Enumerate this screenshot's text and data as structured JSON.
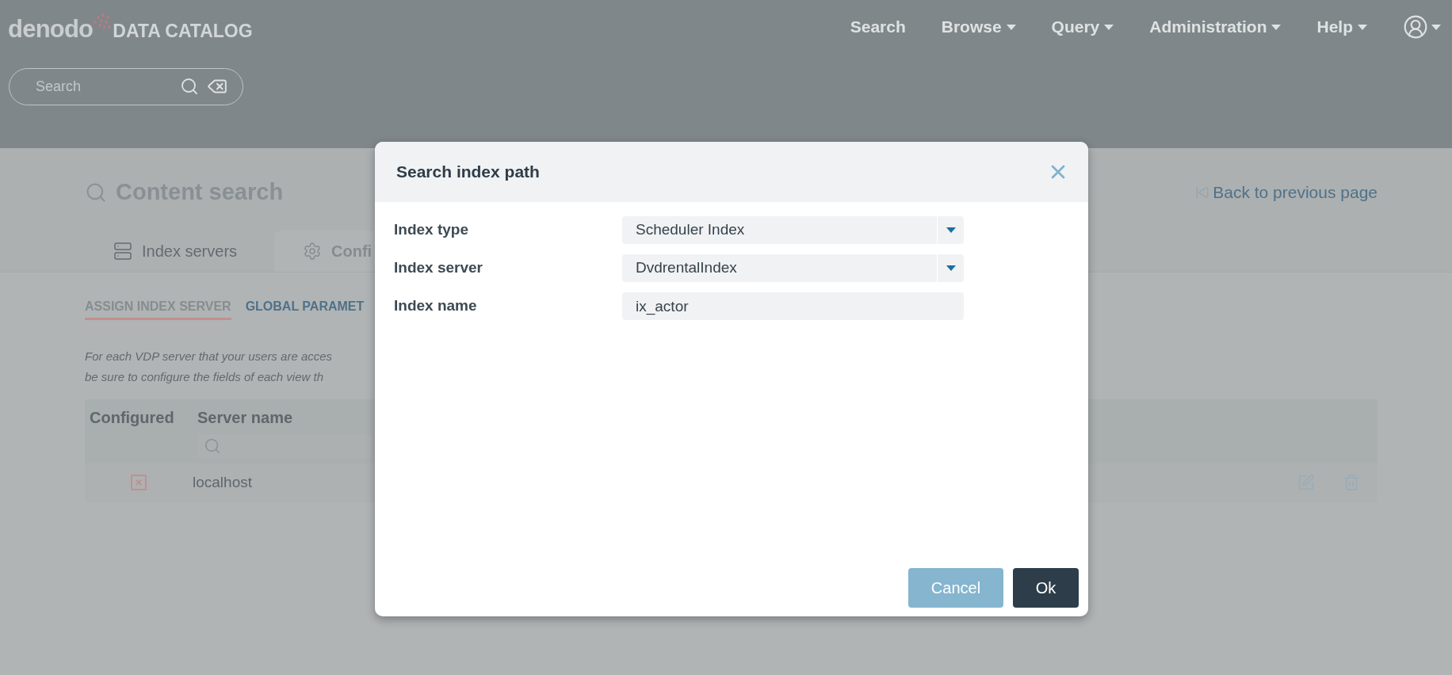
{
  "header": {
    "logo": "denodo",
    "product": "DATA CATALOG",
    "nav": [
      {
        "label": "Search",
        "dropdown": false
      },
      {
        "label": "Browse",
        "dropdown": true
      },
      {
        "label": "Query",
        "dropdown": true
      },
      {
        "label": "Administration",
        "dropdown": true
      },
      {
        "label": "Help",
        "dropdown": true
      }
    ],
    "search": {
      "placeholder": "Search"
    }
  },
  "page": {
    "title": "Content search",
    "back_link": "Back to previous page",
    "tabs": [
      {
        "label": "Index servers",
        "selected": false
      },
      {
        "label": "Confi",
        "selected": true
      }
    ],
    "subtabs": [
      {
        "label": "ASSIGN INDEX SERVER",
        "selected": true
      },
      {
        "label": "GLOBAL PARAMET",
        "selected": false
      }
    ],
    "description": [
      "For each VDP server that your users are acces",
      "be sure to configure the fields of each view th"
    ],
    "table": {
      "columns": [
        "Configured",
        "Server name"
      ],
      "rows": [
        {
          "configured": false,
          "server_name": "localhost"
        }
      ]
    }
  },
  "dialog": {
    "title": "Search index path",
    "fields": [
      {
        "label": "Index type",
        "kind": "select",
        "value": "Scheduler Index"
      },
      {
        "label": "Index server",
        "kind": "select",
        "value": "DvdrentalIndex"
      },
      {
        "label": "Index name",
        "kind": "text",
        "value": "ix_actor"
      }
    ],
    "buttons": [
      {
        "label": "Cancel",
        "kind": "secondary"
      },
      {
        "label": "Ok",
        "kind": "primary"
      }
    ]
  }
}
